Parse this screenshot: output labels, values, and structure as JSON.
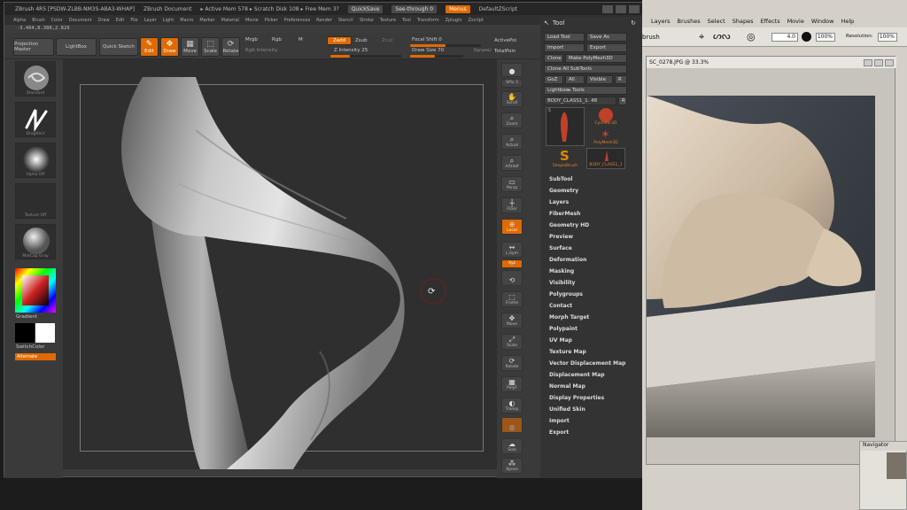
{
  "zbrush": {
    "title_items": [
      "ZBrush 4R5 [PSDW-ZLBB-NM3S-ABA3-WHAP]",
      "ZBrush Document",
      "▸ Active Mem 578 ▸ Scratch Disk 108 ▸ Free Mem 3?"
    ],
    "quicksave": "QuickSave",
    "seethrough": "See-through 0",
    "menus_label": "Menus",
    "script": "DefaultZScript",
    "menu_items": [
      "Alpha",
      "Brush",
      "Color",
      "Document",
      "Draw",
      "Edit",
      "File",
      "Layer",
      "Light",
      "Macro",
      "Marker",
      "Material",
      "Movie",
      "Picker",
      "Preferences",
      "Render",
      "Stencil",
      "Stroke",
      "Texture",
      "Tool",
      "Transform",
      "Zplugin",
      "Zscript"
    ],
    "coords": "-3.464,8.388,2.829",
    "shelf": {
      "projection_master": "Projection Master",
      "lightbox": "LightBox",
      "quick_sketch": "Quick Sketch",
      "edit": "Edit",
      "draw": "Draw",
      "move": "Move",
      "scale": "Scale",
      "rotate": "Rotate",
      "mrgb": "Mrgb",
      "rgb": "Rgb",
      "m": "M",
      "rgb_intensity": "Rgb Intensity",
      "zadd": "Zadd",
      "zsub": "Zsub",
      "zcut": "Zcut",
      "z_intensity": "Z Intensity 25",
      "focal_shift": "Focal Shift 0",
      "draw_size": "Draw Size 70",
      "dynamic": "Dynamic",
      "active_points": "ActivePoi",
      "total_points": "TotalPoin"
    },
    "left_tray": {
      "thumbs": [
        "Standard",
        "DragRect",
        "Alpha Off",
        "Texture Off",
        "MatCap Gray"
      ],
      "gradient": "Gradient",
      "switch_color": "SwitchColor",
      "alternate": "Alternate"
    },
    "right_tray": [
      "BPR",
      "SPix 3",
      "Scroll",
      "Zoom",
      "Actual",
      "AAHalf",
      "Persp",
      "Floor",
      "Local",
      "L.Sym",
      "Xyz",
      "Frame",
      "Move",
      "Scale",
      "Rotate",
      "PolyF",
      "Transp",
      "Ghost",
      "Solo",
      "Xpose"
    ],
    "tool_panel": {
      "title": "Tool",
      "load_tool": "Load Tool",
      "save_as": "Save As",
      "import": "Import",
      "export": "Export",
      "clone": "Clone",
      "make_polymesh": "Make PolyMesh3D",
      "clone_all": "Clone All SubTools",
      "goz": "GoZ",
      "all": "All",
      "visible": "Visible",
      "r": "R",
      "lightbox_tools": "Lightbox▸ Tools",
      "current_tool": "BODY_CLASS1_1. 48",
      "r2": "R",
      "tool_count": "5",
      "thumbs": [
        "",
        "Cylinder3D",
        "PolyMesh3D",
        "SimpleBrush",
        "BODY_CLASS1_1"
      ],
      "subpalettes": [
        "SubTool",
        "Geometry",
        "Layers",
        "FiberMesh",
        "Geometry HD",
        "Preview",
        "Surface",
        "Deformation",
        "Masking",
        "Visibility",
        "Polygroups",
        "Contact",
        "Morph Target",
        "Polypaint",
        "UV Map",
        "Texture Map",
        "Vector Displacement Map",
        "Displacement Map",
        "Normal Map",
        "Display Properties",
        "Unified Skin",
        "Import",
        "Export"
      ]
    }
  },
  "photoshop": {
    "menu_items": [
      "Layers",
      "Brushes",
      "Select",
      "Shapes",
      "Effects",
      "Movie",
      "Window",
      "Help"
    ],
    "brush_label": "brush",
    "brush_size": "4.0",
    "opacity": "100%",
    "resolution_label": "Resolution:",
    "resolution": "100%",
    "doc_title": "SC_0278.JPG @ 33.3%",
    "navigator": "Navigator"
  },
  "colors": {
    "accent": "#e06a00",
    "zbrush_bg": "#3a3a3a",
    "canvas_bg": "#2f2f2f"
  }
}
